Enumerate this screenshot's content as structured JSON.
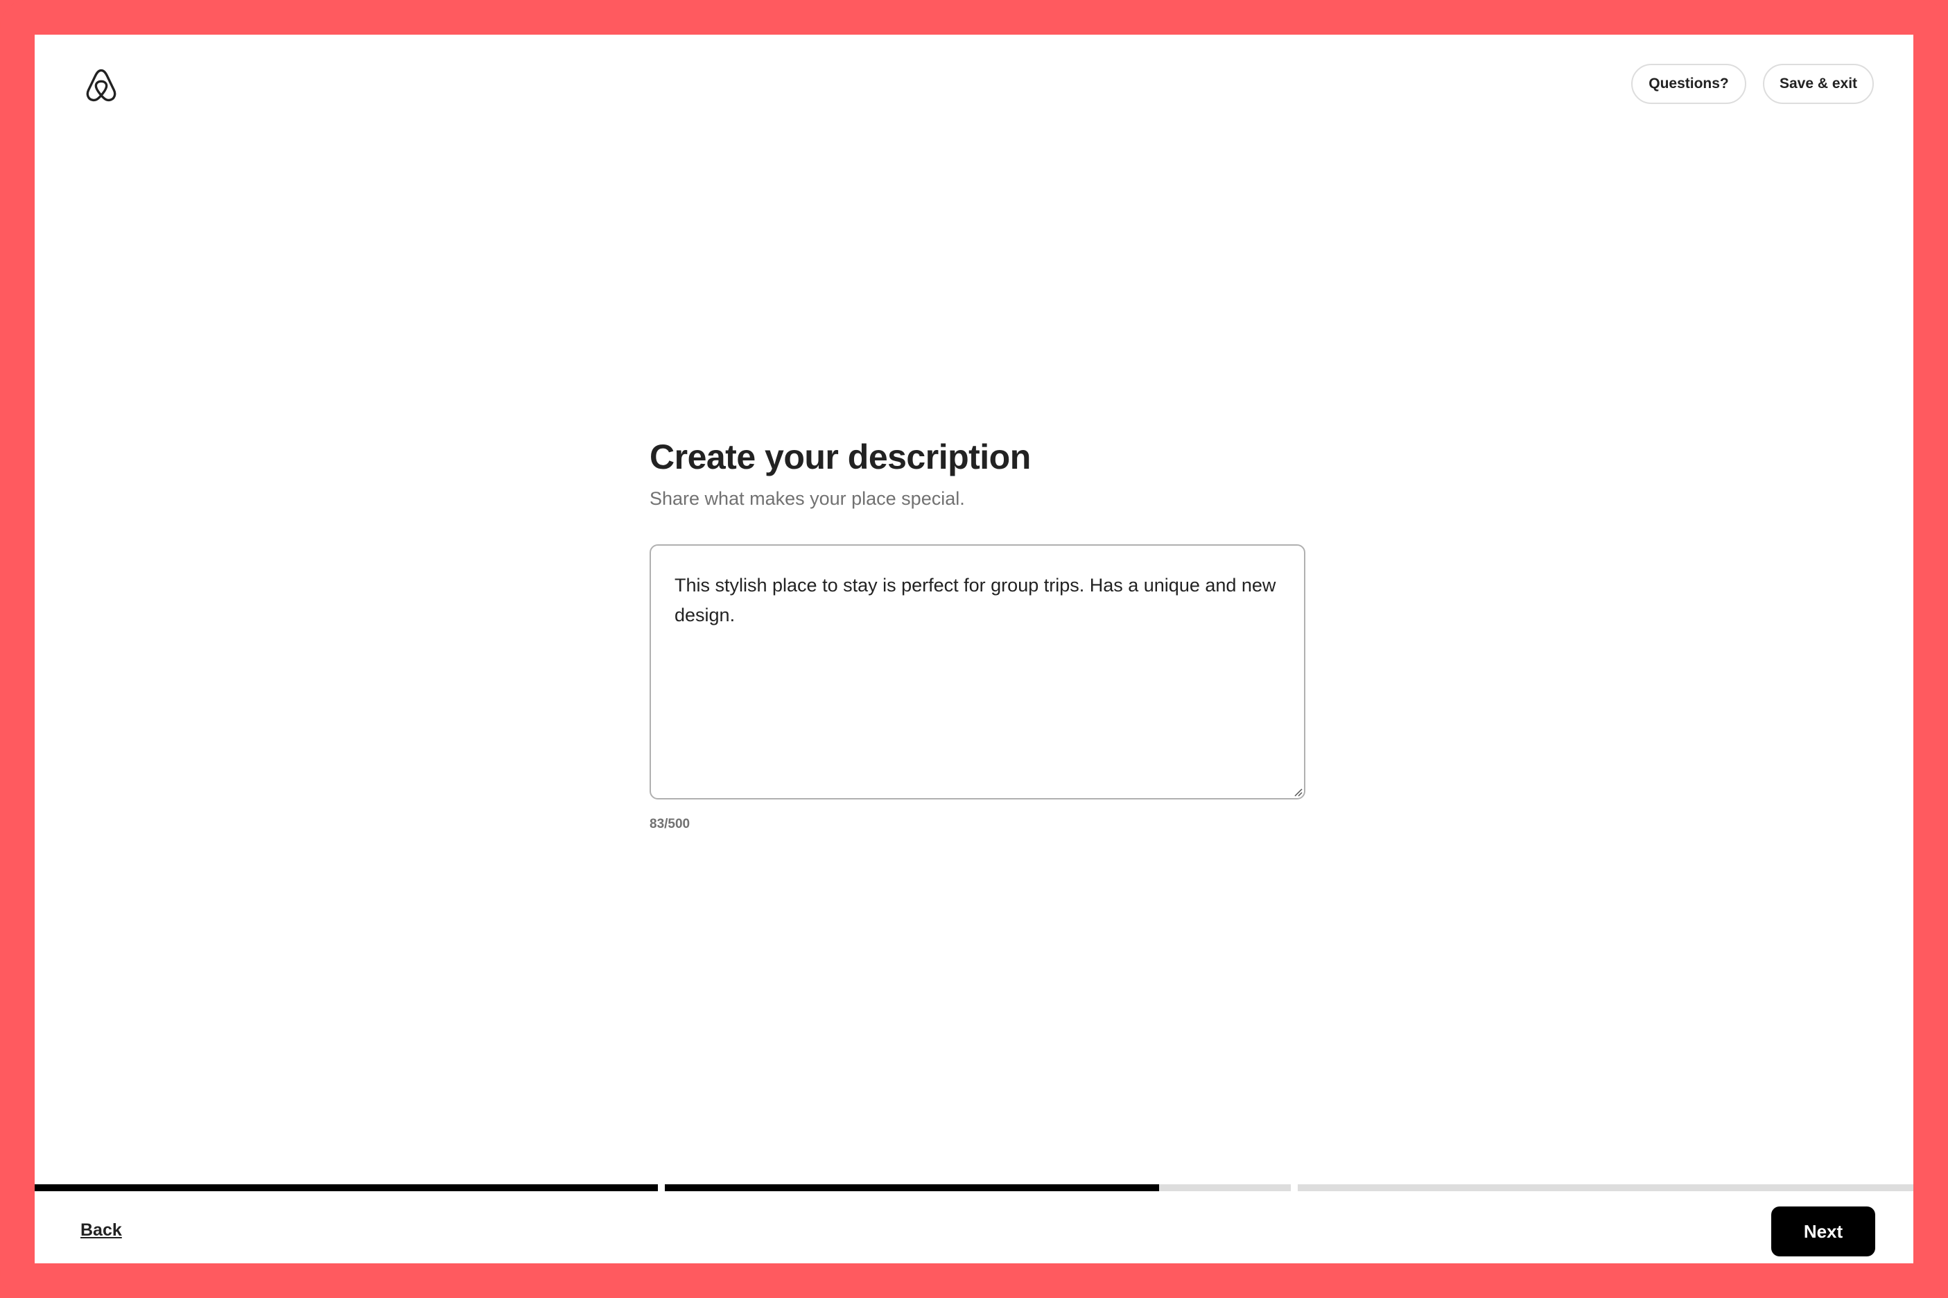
{
  "header": {
    "logo_icon": "airbnb-logo-icon",
    "questions_label": "Questions?",
    "save_exit_label": "Save & exit"
  },
  "main": {
    "title": "Create your description",
    "subtitle": "Share what makes your place special.",
    "description_value": "This stylish place to stay is perfect for group trips. Has a unique and new design.",
    "char_count": "83/500"
  },
  "progress": {
    "steps": [
      {
        "step": 1,
        "fraction_complete": 1.0
      },
      {
        "step": 2,
        "fraction_complete": 1.0
      },
      {
        "step": 3,
        "fraction_complete": 0.0
      }
    ],
    "step2_fill_fraction": 0.79
  },
  "footer": {
    "back_label": "Back",
    "next_label": "Next"
  },
  "colors": {
    "frame": "#FF5A5F",
    "primary_text": "#222222",
    "secondary_text": "#717171",
    "border": "#DDDDDD",
    "progress_fill": "#000000",
    "progress_track": "#DDDDDD",
    "next_button_bg": "#000000"
  }
}
